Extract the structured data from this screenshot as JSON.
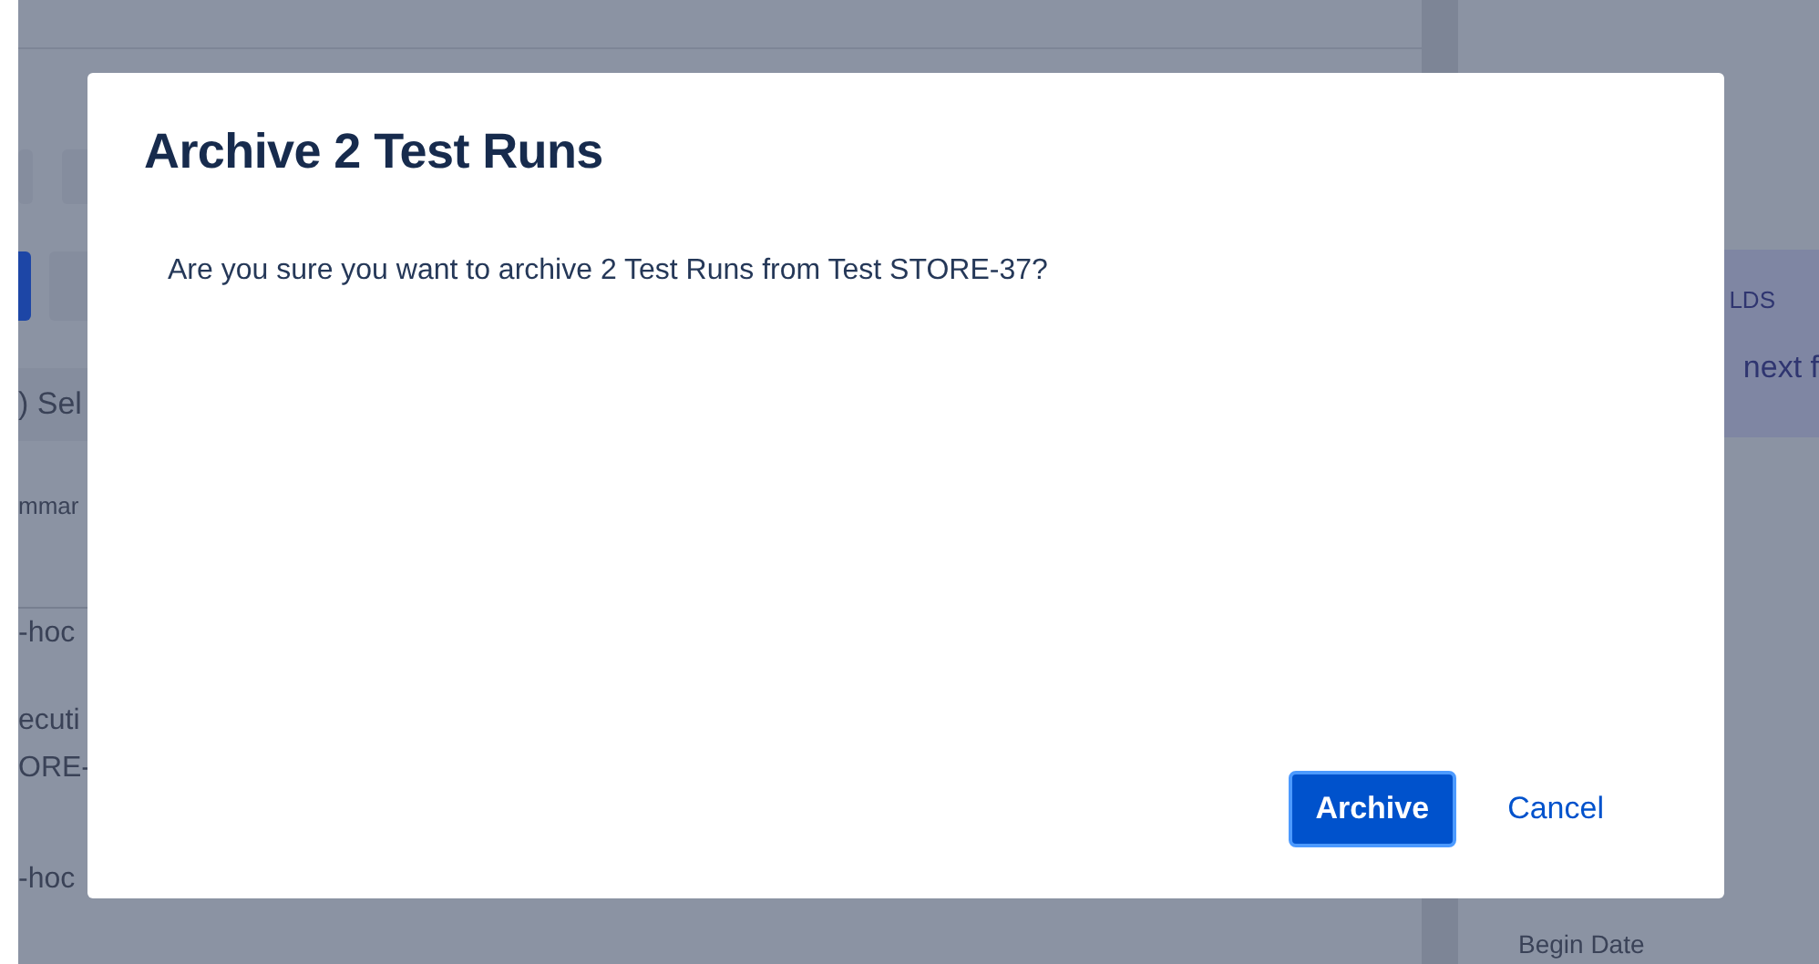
{
  "background": {
    "left_texts": [
      {
        "kind": "tab",
        "text": ") Sel"
      },
      {
        "kind": "header",
        "text": "mmar"
      },
      {
        "kind": "cell",
        "text": "-hoc"
      },
      {
        "kind": "cell",
        "text": "ecuti"
      },
      {
        "kind": "cell",
        "text": "ORE-"
      },
      {
        "kind": "cell",
        "text": "-hoc"
      }
    ],
    "right_texts": [
      {
        "kind": "panel-heading",
        "text": "LDS"
      },
      {
        "kind": "panel-link",
        "text": "next f"
      },
      {
        "kind": "field-label",
        "text": "Begin Date"
      }
    ]
  },
  "dialog": {
    "title": "Archive 2 Test Runs",
    "message": "Are you sure you want to archive 2 Test Runs from Test STORE-37?",
    "buttons": [
      {
        "kind": "primary",
        "label": "Archive"
      },
      {
        "kind": "link",
        "label": "Cancel"
      }
    ]
  }
}
